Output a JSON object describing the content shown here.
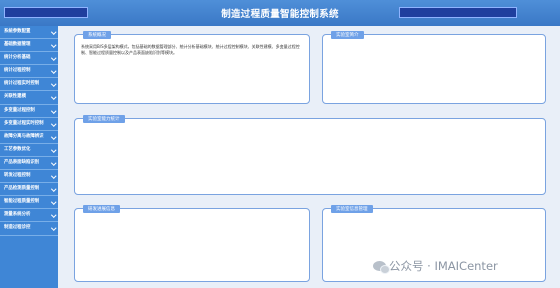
{
  "header": {
    "title": "制造过程质量智能控制系统"
  },
  "sidebar": {
    "items": [
      {
        "label": "系统参数配置",
        "chevron": true
      },
      {
        "label": "基础数据管理",
        "chevron": true
      },
      {
        "label": "统计分析基础",
        "chevron": true
      },
      {
        "label": "统计过程控制",
        "chevron": true
      },
      {
        "label": "统计过程实时控制",
        "chevron": true
      },
      {
        "label": "关联性建模",
        "chevron": true
      },
      {
        "label": "多变量过程控制",
        "chevron": true
      },
      {
        "label": "多变量过程实时控制",
        "chevron": true
      },
      {
        "label": "故障分离与故障辨识",
        "chevron": true
      },
      {
        "label": "工艺参数优化",
        "chevron": true
      },
      {
        "label": "产品表面缺陷识别",
        "chevron": true
      },
      {
        "label": "转发过程控制",
        "chevron": true
      },
      {
        "label": "产品检测质量控制",
        "chevron": true
      },
      {
        "label": "智能过程质量控制",
        "chevron": true
      },
      {
        "label": "测量系统分析",
        "chevron": true
      },
      {
        "label": "制造过程诊控",
        "chevron": true
      }
    ]
  },
  "panels": {
    "intro": {
      "title": "系统概况",
      "text": "系统采用B/S多层架构模式，包括基础的数据管理部分、统计分析基础模块、统计过程控制模块、关联性建模、多变量过程控制、智能过程质量控制以及产品表面缺陷识别等模块。"
    },
    "lab": {
      "title": "实验室简介"
    },
    "capability": {
      "title": "实验室能力统计"
    },
    "research": {
      "title": "研发进展信息"
    },
    "experiment": {
      "title": "实验室信息管理"
    }
  },
  "watermark": {
    "text": "公众号 · IMAICenter"
  }
}
